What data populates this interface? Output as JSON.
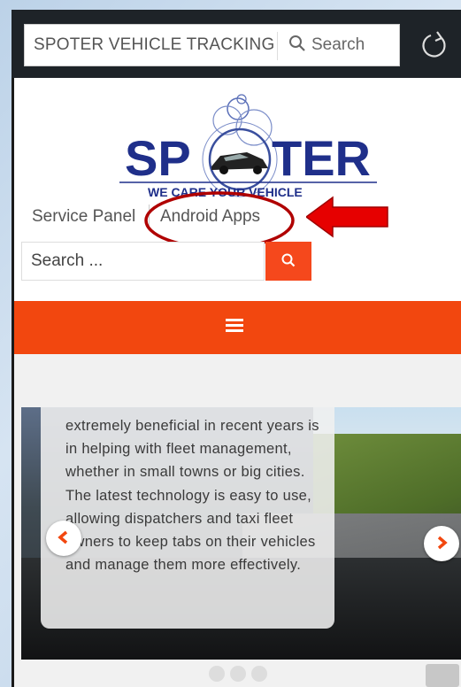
{
  "browser": {
    "url_title": "SPOTER VEHICLE TRACKING",
    "search_label": "Search",
    "search_icon": "search-icon",
    "refresh_icon": "refresh-icon"
  },
  "site": {
    "logo_text": "SPOTER",
    "tagline": "WE CARE YOUR VEHICLE",
    "menu": [
      "Service Panel",
      "Android Apps"
    ],
    "search_placeholder": "Search ..."
  },
  "slider": {
    "caption": "extremely beneficial in recent years is in helping with fleet management, whether in small towns or big cities. The latest technology is easy to use, allowing dispatchers and taxi fleet owners to keep tabs on their vehicles and manage them more effectively.",
    "dots": 3
  },
  "colors": {
    "accent": "#f2470f",
    "annotation": "#c40000",
    "logo_blue": "#1f2f8a"
  }
}
